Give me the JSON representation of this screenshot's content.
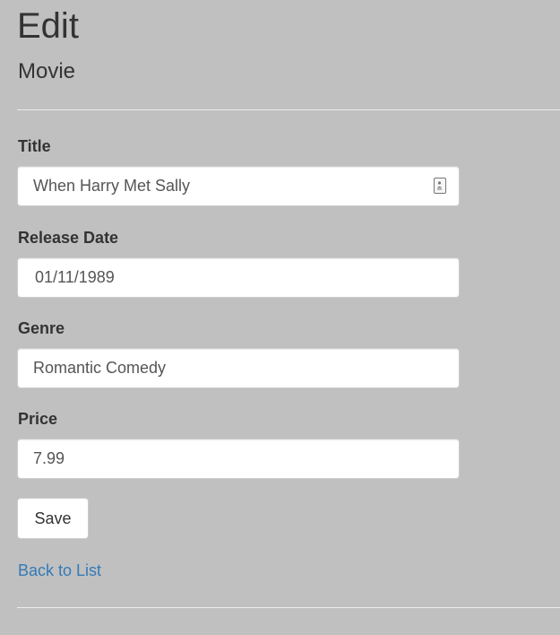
{
  "header": {
    "title": "Edit",
    "subtitle": "Movie"
  },
  "form": {
    "fields": [
      {
        "label": "Title",
        "value": "When Harry Met Sally"
      },
      {
        "label": "Release Date",
        "value": "01/11/1989"
      },
      {
        "label": "Genre",
        "value": "Romantic Comedy"
      },
      {
        "label": "Price",
        "value": "7.99"
      }
    ],
    "save_label": "Save"
  },
  "links": {
    "back_to_list": "Back to List"
  },
  "icons": {
    "title_field_icon": "autofill-contact-icon"
  },
  "colors": {
    "page_background": "#c0c0c0",
    "link": "#337ab7",
    "text": "#333333"
  }
}
